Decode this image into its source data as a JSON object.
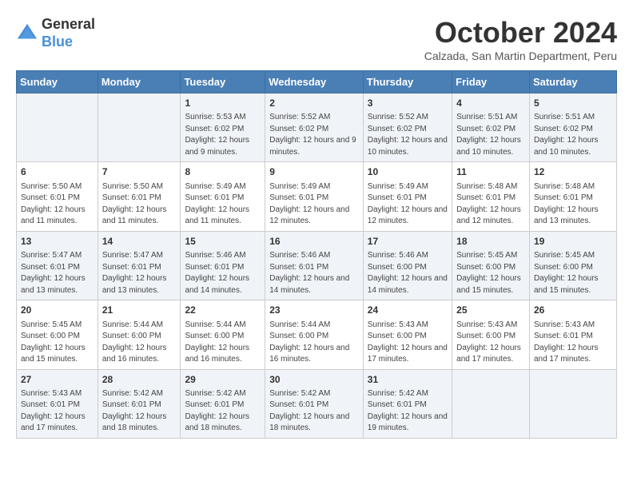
{
  "header": {
    "logo_general": "General",
    "logo_blue": "Blue",
    "month_title": "October 2024",
    "location": "Calzada, San Martin Department, Peru"
  },
  "weekdays": [
    "Sunday",
    "Monday",
    "Tuesday",
    "Wednesday",
    "Thursday",
    "Friday",
    "Saturday"
  ],
  "weeks": [
    [
      {
        "day": "",
        "content": ""
      },
      {
        "day": "",
        "content": ""
      },
      {
        "day": "1",
        "content": "Sunrise: 5:53 AM\nSunset: 6:02 PM\nDaylight: 12 hours and 9 minutes."
      },
      {
        "day": "2",
        "content": "Sunrise: 5:52 AM\nSunset: 6:02 PM\nDaylight: 12 hours and 9 minutes."
      },
      {
        "day": "3",
        "content": "Sunrise: 5:52 AM\nSunset: 6:02 PM\nDaylight: 12 hours and 10 minutes."
      },
      {
        "day": "4",
        "content": "Sunrise: 5:51 AM\nSunset: 6:02 PM\nDaylight: 12 hours and 10 minutes."
      },
      {
        "day": "5",
        "content": "Sunrise: 5:51 AM\nSunset: 6:02 PM\nDaylight: 12 hours and 10 minutes."
      }
    ],
    [
      {
        "day": "6",
        "content": "Sunrise: 5:50 AM\nSunset: 6:01 PM\nDaylight: 12 hours and 11 minutes."
      },
      {
        "day": "7",
        "content": "Sunrise: 5:50 AM\nSunset: 6:01 PM\nDaylight: 12 hours and 11 minutes."
      },
      {
        "day": "8",
        "content": "Sunrise: 5:49 AM\nSunset: 6:01 PM\nDaylight: 12 hours and 11 minutes."
      },
      {
        "day": "9",
        "content": "Sunrise: 5:49 AM\nSunset: 6:01 PM\nDaylight: 12 hours and 12 minutes."
      },
      {
        "day": "10",
        "content": "Sunrise: 5:49 AM\nSunset: 6:01 PM\nDaylight: 12 hours and 12 minutes."
      },
      {
        "day": "11",
        "content": "Sunrise: 5:48 AM\nSunset: 6:01 PM\nDaylight: 12 hours and 12 minutes."
      },
      {
        "day": "12",
        "content": "Sunrise: 5:48 AM\nSunset: 6:01 PM\nDaylight: 12 hours and 13 minutes."
      }
    ],
    [
      {
        "day": "13",
        "content": "Sunrise: 5:47 AM\nSunset: 6:01 PM\nDaylight: 12 hours and 13 minutes."
      },
      {
        "day": "14",
        "content": "Sunrise: 5:47 AM\nSunset: 6:01 PM\nDaylight: 12 hours and 13 minutes."
      },
      {
        "day": "15",
        "content": "Sunrise: 5:46 AM\nSunset: 6:01 PM\nDaylight: 12 hours and 14 minutes."
      },
      {
        "day": "16",
        "content": "Sunrise: 5:46 AM\nSunset: 6:01 PM\nDaylight: 12 hours and 14 minutes."
      },
      {
        "day": "17",
        "content": "Sunrise: 5:46 AM\nSunset: 6:00 PM\nDaylight: 12 hours and 14 minutes."
      },
      {
        "day": "18",
        "content": "Sunrise: 5:45 AM\nSunset: 6:00 PM\nDaylight: 12 hours and 15 minutes."
      },
      {
        "day": "19",
        "content": "Sunrise: 5:45 AM\nSunset: 6:00 PM\nDaylight: 12 hours and 15 minutes."
      }
    ],
    [
      {
        "day": "20",
        "content": "Sunrise: 5:45 AM\nSunset: 6:00 PM\nDaylight: 12 hours and 15 minutes."
      },
      {
        "day": "21",
        "content": "Sunrise: 5:44 AM\nSunset: 6:00 PM\nDaylight: 12 hours and 16 minutes."
      },
      {
        "day": "22",
        "content": "Sunrise: 5:44 AM\nSunset: 6:00 PM\nDaylight: 12 hours and 16 minutes."
      },
      {
        "day": "23",
        "content": "Sunrise: 5:44 AM\nSunset: 6:00 PM\nDaylight: 12 hours and 16 minutes."
      },
      {
        "day": "24",
        "content": "Sunrise: 5:43 AM\nSunset: 6:00 PM\nDaylight: 12 hours and 17 minutes."
      },
      {
        "day": "25",
        "content": "Sunrise: 5:43 AM\nSunset: 6:00 PM\nDaylight: 12 hours and 17 minutes."
      },
      {
        "day": "26",
        "content": "Sunrise: 5:43 AM\nSunset: 6:01 PM\nDaylight: 12 hours and 17 minutes."
      }
    ],
    [
      {
        "day": "27",
        "content": "Sunrise: 5:43 AM\nSunset: 6:01 PM\nDaylight: 12 hours and 17 minutes."
      },
      {
        "day": "28",
        "content": "Sunrise: 5:42 AM\nSunset: 6:01 PM\nDaylight: 12 hours and 18 minutes."
      },
      {
        "day": "29",
        "content": "Sunrise: 5:42 AM\nSunset: 6:01 PM\nDaylight: 12 hours and 18 minutes."
      },
      {
        "day": "30",
        "content": "Sunrise: 5:42 AM\nSunset: 6:01 PM\nDaylight: 12 hours and 18 minutes."
      },
      {
        "day": "31",
        "content": "Sunrise: 5:42 AM\nSunset: 6:01 PM\nDaylight: 12 hours and 19 minutes."
      },
      {
        "day": "",
        "content": ""
      },
      {
        "day": "",
        "content": ""
      }
    ]
  ]
}
